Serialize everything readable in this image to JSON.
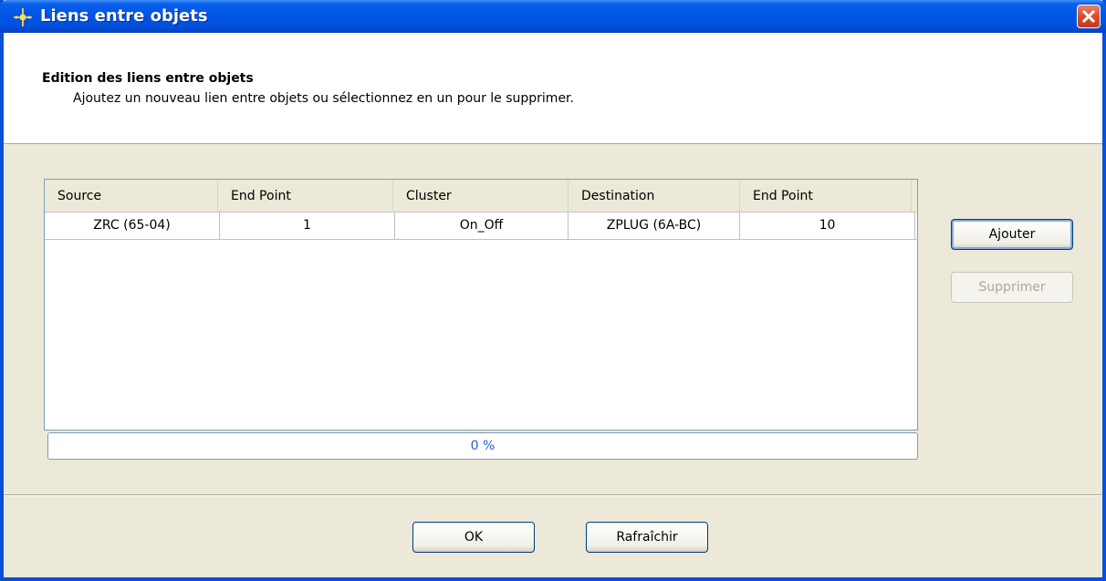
{
  "window": {
    "title": "Liens entre objets",
    "icon": "sparkle-icon"
  },
  "header": {
    "title": "Edition des liens entre objets",
    "subtitle": "Ajoutez un nouveau lien entre objets ou sélectionnez en un pour le supprimer."
  },
  "table": {
    "columns": [
      "Source",
      "End Point",
      "Cluster",
      "Destination",
      "End Point"
    ],
    "rows": [
      [
        "ZRC (65-04)",
        "1",
        "On_Off",
        "ZPLUG (6A-BC)",
        "10"
      ]
    ]
  },
  "progress": {
    "label": "0 %",
    "value": 0
  },
  "buttons": {
    "add": "Ajouter",
    "delete": "Supprimer",
    "ok": "OK",
    "refresh": "Rafraîchir"
  },
  "colors": {
    "titlebar": "#0055e5",
    "face": "#ece9d8",
    "progress_text": "#1e5fcf"
  }
}
